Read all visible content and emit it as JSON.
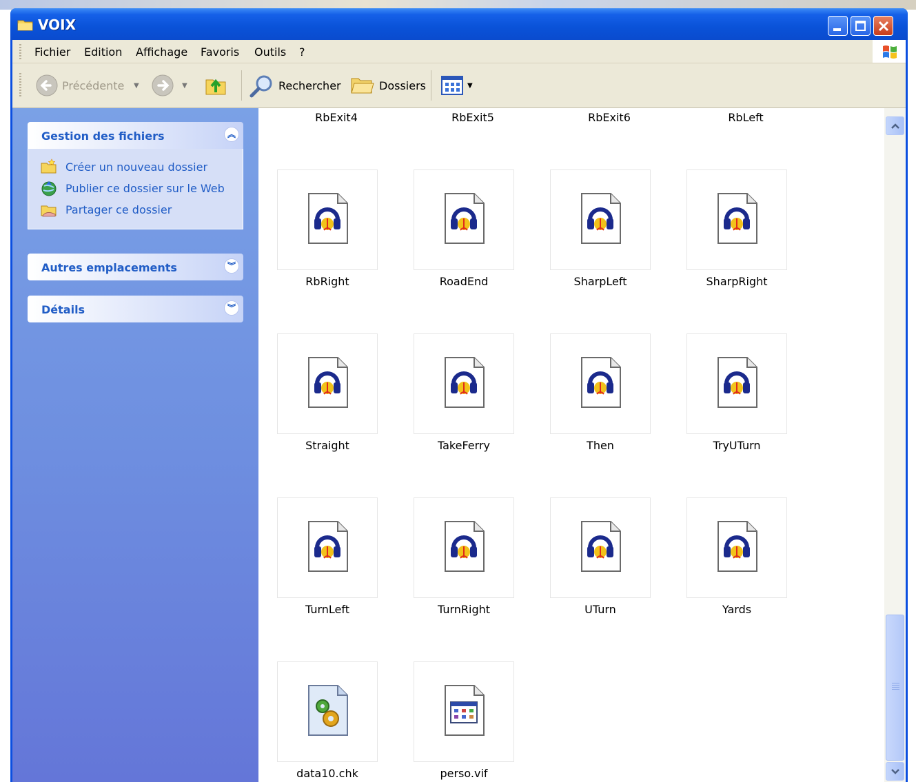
{
  "window": {
    "title": "VOIX"
  },
  "menu": [
    "Fichier",
    "Edition",
    "Affichage",
    "Favoris",
    "Outils",
    "?"
  ],
  "toolbar": {
    "back_label": "Précédente",
    "search_label": "Rechercher",
    "folders_label": "Dossiers"
  },
  "sidebar": {
    "file_tasks": {
      "title": "Gestion des fichiers",
      "tasks": [
        "Créer un nouveau dossier",
        "Publier ce dossier sur le Web",
        "Partager ce dossier"
      ]
    },
    "other_places": {
      "title": "Autres emplacements"
    },
    "details": {
      "title": "Détails"
    }
  },
  "content": {
    "partial_labels": [
      "RbExit4",
      "RbExit5",
      "RbExit6",
      "RbLeft"
    ],
    "files": [
      "RbRight",
      "RoadEnd",
      "SharpLeft",
      "SharpRight",
      "Straight",
      "TakeFerry",
      "Then",
      "TryUTurn",
      "TurnLeft",
      "TurnRight",
      "UTurn",
      "Yards",
      "data10.chk",
      "perso.vif"
    ]
  }
}
